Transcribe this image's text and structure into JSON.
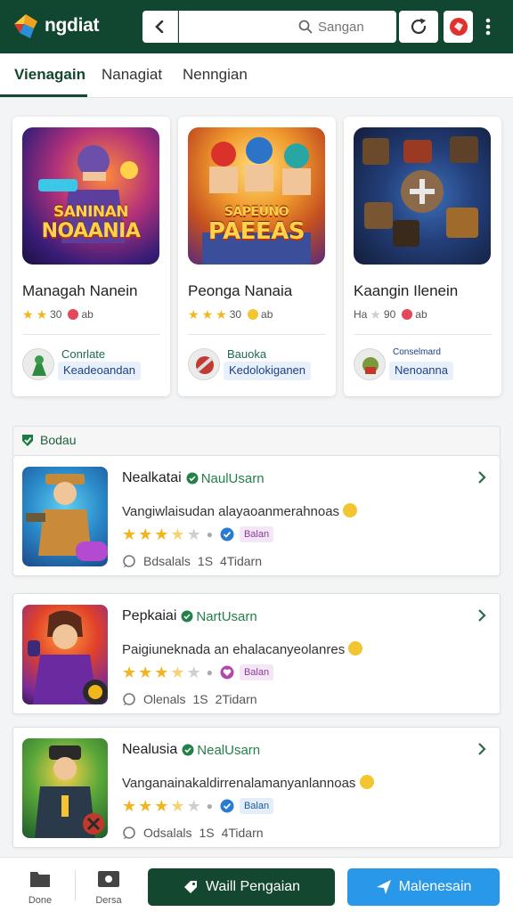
{
  "header": {
    "brand": "ngdiat",
    "search": {
      "placeholder": "Sangan"
    }
  },
  "tabs": [
    {
      "label": "Vienagain",
      "active": true
    },
    {
      "label": "Nanagiat",
      "active": false
    },
    {
      "label": "Nenngian",
      "active": false
    }
  ],
  "featured": [
    {
      "art_text_1": "SANINAN",
      "art_text_2": "NOAANIA",
      "title": "Managah Nanein",
      "rating_text": "30",
      "rating_suffix": "ab",
      "developer": "Conrlate",
      "developer_tag": "Keadeoandan"
    },
    {
      "art_text_1": "SAPEUNO",
      "art_text_2": "PAEEAS",
      "title": "Peonga Nanaia",
      "rating_text": "30",
      "rating_suffix": "ab",
      "developer": "Bauoka",
      "developer_tag": "Kedolokiganen"
    },
    {
      "art_text_1": "",
      "art_text_2": "",
      "title": "Kaangin Ilenein",
      "rating_text": "90",
      "rating_prefix": "Ha",
      "rating_suffix": "ab",
      "developer": "Conselmard",
      "developer_tag": "Nenoanna"
    }
  ],
  "section": {
    "title": "Bodau"
  },
  "list": [
    {
      "title": "Nealkatai",
      "verified": "NaulUsarn",
      "description": "Vangiwlaisudan alayaoanmerahnoas",
      "stars": 3.5,
      "badge": "Balan",
      "meta_1": "Bdsalals",
      "meta_2": "1S",
      "meta_3": "4Tidarn"
    },
    {
      "title": "Pepkaiai",
      "verified": "NartUsarn",
      "description": "Paigiuneknada an ehalacanyeolanres",
      "stars": 3.5,
      "badge": "Balan",
      "meta_1": "Olenals",
      "meta_2": "1S",
      "meta_3": "2Tidarn"
    },
    {
      "title": "Nealusia",
      "verified": "NealUsarn",
      "description": "Vanganainakaldirrenalamanyanlannoas",
      "stars": 3.5,
      "badge": "Balan",
      "meta_1": "Odsalals",
      "meta_2": "1S",
      "meta_3": "4Tidarn"
    }
  ],
  "bottom_bar": {
    "nav": [
      {
        "label": "Done"
      },
      {
        "label": "Dersa"
      }
    ],
    "primary_button": "Waill Pengaian",
    "secondary_button": "Malenesain"
  },
  "colors": {
    "header_bg": "#114630",
    "accent_green": "#13472f",
    "cta_blue": "#2a98e8",
    "star": "#f3b51c"
  }
}
